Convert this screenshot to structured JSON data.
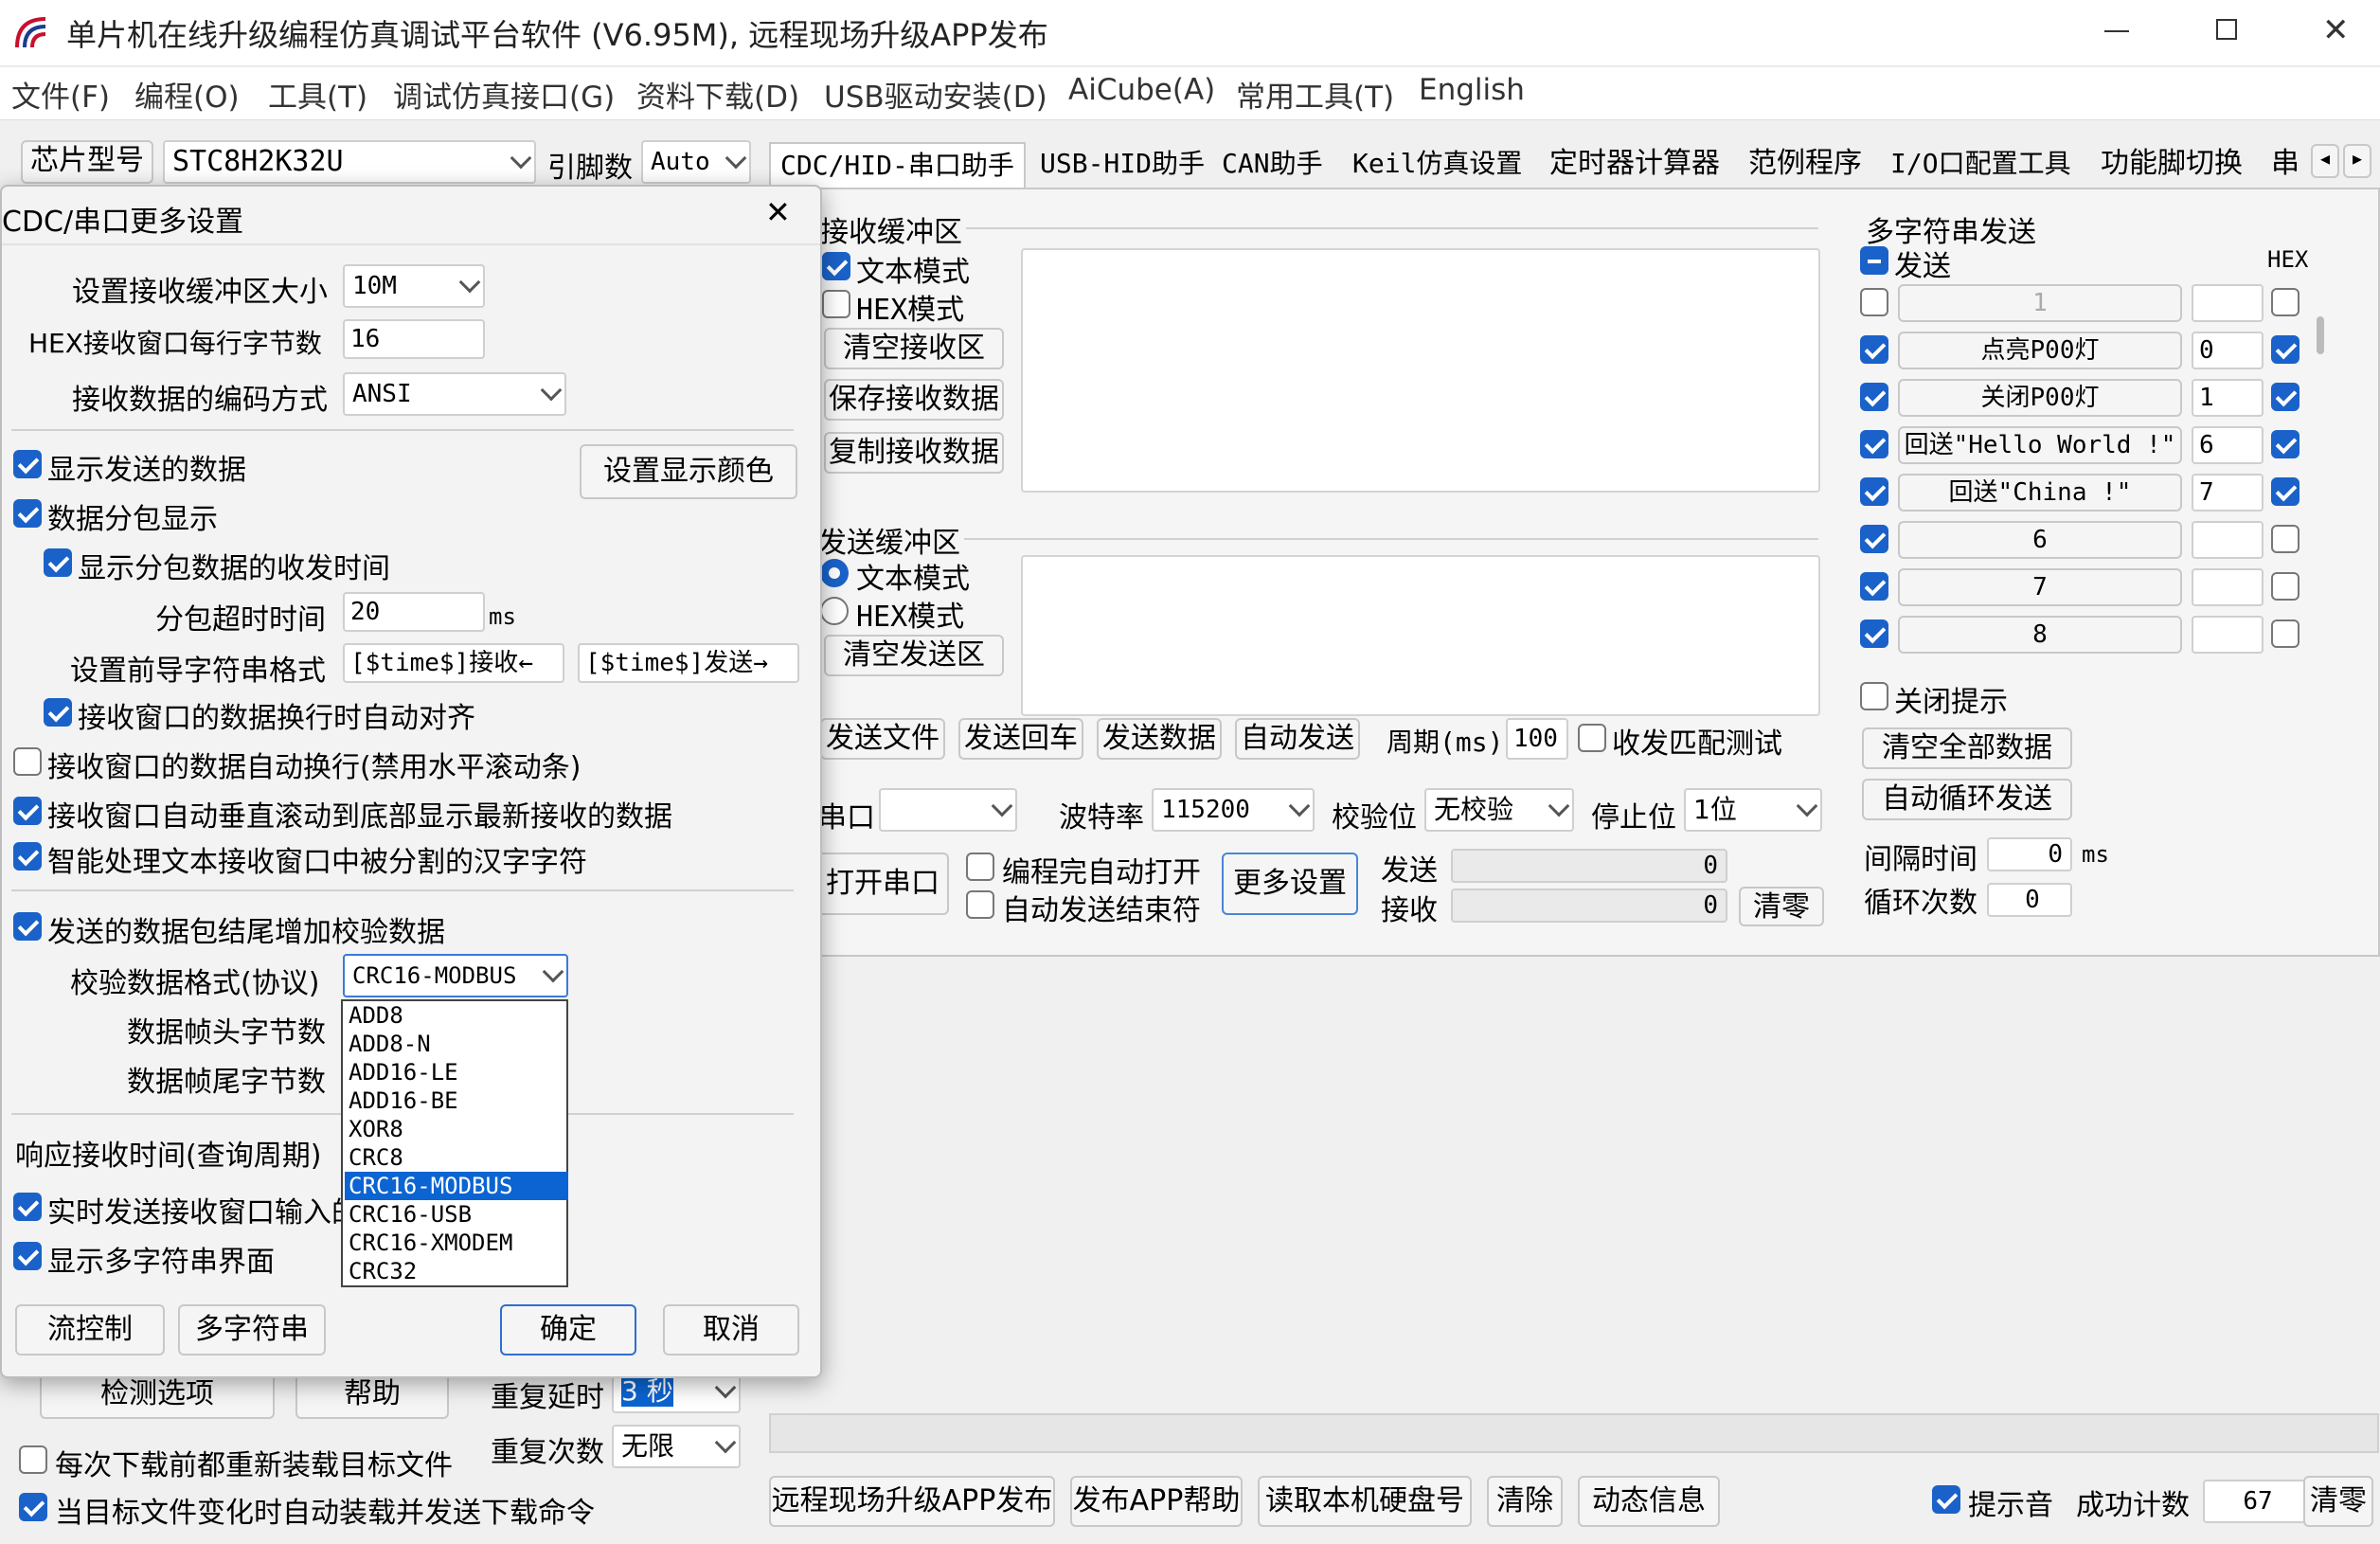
{
  "window": {
    "title": "单片机在线升级编程仿真调试平台软件 (V6.95M), 远程现场升级APP发布"
  },
  "menu": [
    "文件(F)",
    "编程(O)",
    "工具(T)",
    "调试仿真接口(G)",
    "资料下载(D)",
    "USB驱动安装(D)",
    "AiCube(A)",
    "常用工具(T)",
    "English"
  ],
  "toolbar": {
    "chip_label": "芯片型号",
    "chip_value": "STC8H2K32U",
    "pins_label": "引脚数",
    "pins_value": "Auto"
  },
  "tabs": [
    "CDC/HID-串口助手",
    "USB-HID助手",
    "CAN助手",
    "Keil仿真设置",
    "定时器计算器",
    "范例程序",
    "I/O口配置工具",
    "功能脚切换",
    "串"
  ],
  "receive": {
    "title": "接收缓冲区",
    "text_mode": "文本模式",
    "hex_mode": "HEX模式",
    "clear": "清空接收区",
    "save": "保存接收数据",
    "copy": "复制接收数据"
  },
  "send": {
    "title": "发送缓冲区",
    "text_mode": "文本模式",
    "hex_mode": "HEX模式",
    "clear": "清空发送区",
    "btn_file": "发送文件",
    "btn_enter": "发送回车",
    "btn_data": "发送数据",
    "btn_auto": "自动发送",
    "period_label": "周期(ms)",
    "period_value": "100",
    "match_test": "收发匹配测试"
  },
  "serial": {
    "port_label": "串口",
    "port_value": "",
    "baud_label": "波特率",
    "baud_value": "115200",
    "parity_label": "校验位",
    "parity_value": "无校验",
    "stop_label": "停止位",
    "stop_value": "1位",
    "open": "打开串口",
    "auto_open": "编程完自动打开",
    "auto_end": "自动发送结束符",
    "more": "更多设置",
    "tx_label": "发送",
    "tx_value": "0",
    "rx_label": "接收",
    "rx_value": "0",
    "clear": "清零"
  },
  "multi": {
    "title": "多字符串发送",
    "send_label": "发送",
    "hex_label": "HEX",
    "rows": [
      {
        "enabled": false,
        "text": "1",
        "value": "",
        "hex": false
      },
      {
        "enabled": true,
        "text": "点亮P00灯",
        "value": "0",
        "hex": true
      },
      {
        "enabled": true,
        "text": "关闭P00灯",
        "value": "1",
        "hex": true
      },
      {
        "enabled": true,
        "text": "回送\"Hello World !\"",
        "value": "6",
        "hex": true
      },
      {
        "enabled": true,
        "text": "回送\"China !\"",
        "value": "7",
        "hex": true
      },
      {
        "enabled": true,
        "text": "6",
        "value": "",
        "hex": false
      },
      {
        "enabled": true,
        "text": "7",
        "value": "",
        "hex": false
      },
      {
        "enabled": true,
        "text": "8",
        "value": "",
        "hex": false
      }
    ],
    "close_tip": "关闭提示",
    "clear_all": "清空全部数据",
    "auto_loop": "自动循环发送",
    "interval_label": "间隔时间",
    "interval_value": "0",
    "interval_unit": "ms",
    "loop_label": "循环次数",
    "loop_value": "0"
  },
  "lower": {
    "detect": "检测选项",
    "help": "帮助",
    "repeat_delay_label": "重复延时",
    "repeat_delay_value": "3 秒",
    "repeat_count_label": "重复次数",
    "repeat_count_value": "无限",
    "reload_each": "每次下载前都重新装载目标文件",
    "auto_reload": "当目标文件变化时自动装载并发送下载命令",
    "btn_publish": "远程现场升级APP发布",
    "btn_publish_help": "发布APP帮助",
    "btn_disk": "读取本机硬盘号",
    "btn_clear": "清除",
    "btn_dynamic": "动态信息",
    "sound": "提示音",
    "success_label": "成功计数",
    "success_value": "67",
    "clear_count": "清零"
  },
  "dialog": {
    "title": "CDC/串口更多设置",
    "buf_label": "设置接收缓冲区大小",
    "buf_value": "10M",
    "hexbytes_label": "HEX接收窗口每行字节数",
    "hexbytes_value": "16",
    "encoding_label": "接收数据的编码方式",
    "encoding_value": "ANSI",
    "show_sent": "显示发送的数据",
    "color_btn": "设置显示颜色",
    "packet_show": "数据分包显示",
    "packet_time": "显示分包数据的收发时间",
    "timeout_label": "分包超时时间",
    "timeout_value": "20",
    "timeout_unit": "ms",
    "prefix_label": "设置前导字符串格式",
    "prefix_rx": "[$time$]接收←",
    "prefix_tx": "[$time$]发送→",
    "align": "接收窗口的数据换行时自动对齐",
    "wrap": "接收窗口的数据自动换行(禁用水平滚动条)",
    "autoscroll": "接收窗口自动垂直滚动到底部显示最新接收的数据",
    "smart_cn": "智能处理文本接收窗口中被分割的汉字字符",
    "checksum": "发送的数据包结尾增加校验数据",
    "format_label": "校验数据格式(协议)",
    "format_value": "CRC16-MODBUS",
    "head_label": "数据帧头字节数",
    "tail_label": "数据帧尾字节数",
    "resp_label": "响应接收时间(查询周期)",
    "realtime": "实时发送接收窗口输入的",
    "show_multi": "显示多字符串界面",
    "flow": "流控制",
    "multistr": "多字符串",
    "ok": "确定",
    "cancel": "取消",
    "format_options": [
      "ADD8",
      "ADD8-N",
      "ADD16-LE",
      "ADD16-BE",
      "XOR8",
      "CRC8",
      "CRC16-MODBUS",
      "CRC16-USB",
      "CRC16-XMODEM",
      "CRC32"
    ]
  }
}
